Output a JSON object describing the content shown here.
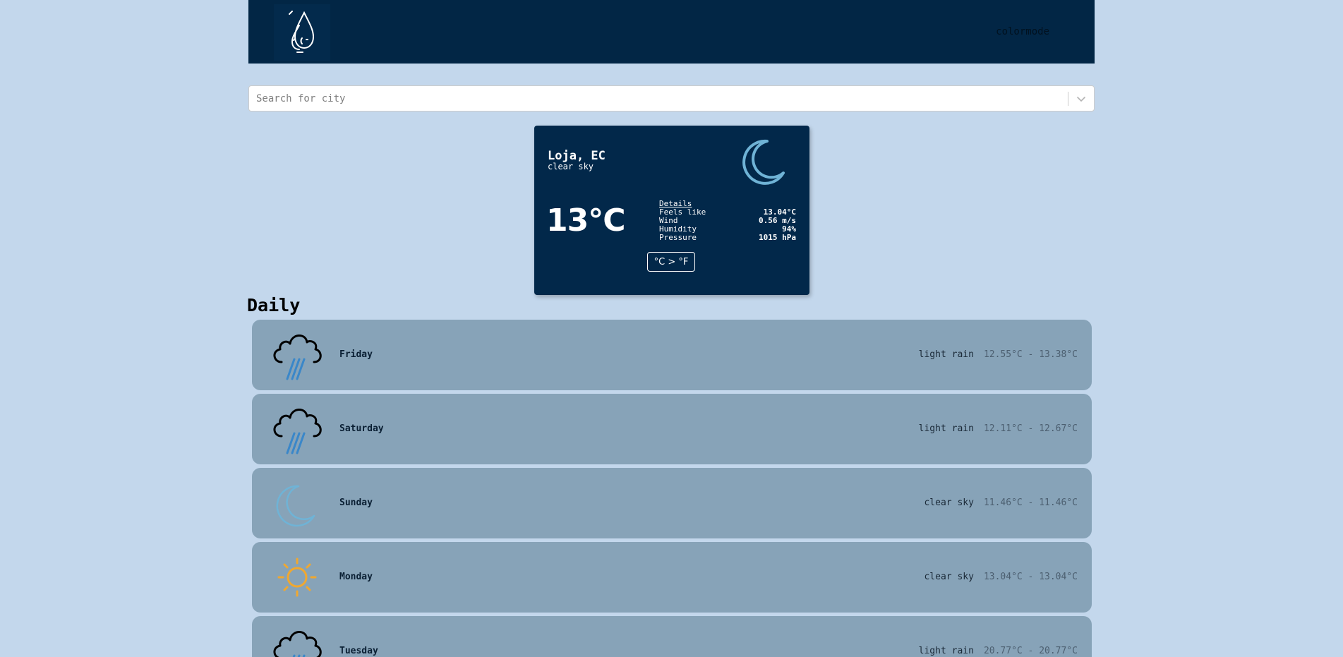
{
  "header": {
    "logo_icon": "raindrops-logo-icon",
    "colormode_label": "colormode"
  },
  "search": {
    "placeholder": "Search for city",
    "value": ""
  },
  "current": {
    "city": "Loja, EC",
    "description": "clear sky",
    "icon": "moon-icon",
    "temperature": "13°C",
    "details_title": "Details",
    "details": [
      {
        "label": "Feels like",
        "value": "13.04°C"
      },
      {
        "label": "Wind",
        "value": "0.56 m/s"
      },
      {
        "label": "Humidity",
        "value": "94%"
      },
      {
        "label": "Pressure",
        "value": "1015 hPa"
      }
    ],
    "unit_toggle_label": "°C > °F"
  },
  "daily": {
    "title": "Daily",
    "days": [
      {
        "name": "Friday",
        "description": "light rain",
        "range": "12.55°C - 13.38°C",
        "icon": "rain-cloud-icon"
      },
      {
        "name": "Saturday",
        "description": "light rain",
        "range": "12.11°C - 12.67°C",
        "icon": "rain-cloud-icon"
      },
      {
        "name": "Sunday",
        "description": "clear sky",
        "range": "11.46°C - 11.46°C",
        "icon": "moon-icon"
      },
      {
        "name": "Monday",
        "description": "clear sky",
        "range": "13.04°C - 13.04°C",
        "icon": "sun-icon"
      },
      {
        "name": "Tuesday",
        "description": "light rain",
        "range": "20.77°C - 20.77°C",
        "icon": "rain-cloud-icon"
      }
    ]
  },
  "colors": {
    "background": "#c3d7ec",
    "header": "#022645",
    "card": "#02284a",
    "day_row": "#87a3b8",
    "moon": "#6fb3d6",
    "sun": "#f0a830",
    "rain": "#3a87c9"
  }
}
